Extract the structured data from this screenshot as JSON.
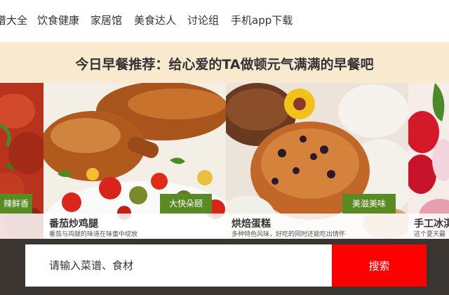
{
  "nav": {
    "items": [
      {
        "label": "谱大全"
      },
      {
        "label": "饮食健康"
      },
      {
        "label": "家居馆"
      },
      {
        "label": "美食达人"
      },
      {
        "label": "讨论组"
      },
      {
        "label": "手机app下载"
      }
    ]
  },
  "banner": {
    "text": "今日早餐推荐：给心爱的TA做顿元气满满的早餐吧"
  },
  "carousel": {
    "cards": [
      {
        "tag": "辣鲜香",
        "title": "",
        "desc": "",
        "image": "crayfish-photo"
      },
      {
        "tag": "大快朵颐",
        "title": "番茄炒鸡腿",
        "desc": "番茄与鸡腿的味道在味蕾中绽放",
        "image": "roast-chicken-photo"
      },
      {
        "tag": "美滋美味",
        "title": "烘焙蛋糕",
        "desc": "多种特色风味，好吃的同时还能吃出情怀",
        "image": "muffin-photo"
      },
      {
        "tag": "",
        "title": "手工冰淇",
        "desc": "这个夏天最",
        "image": "strawberry-photo"
      }
    ]
  },
  "search": {
    "placeholder": "请输入菜谱、食材",
    "button_label": "搜索"
  },
  "colors": {
    "banner_bg": "#f9e9cf",
    "tag_green": "#5a8a24",
    "search_bar_bg": "#3a3530",
    "search_button": "#ff0000"
  }
}
